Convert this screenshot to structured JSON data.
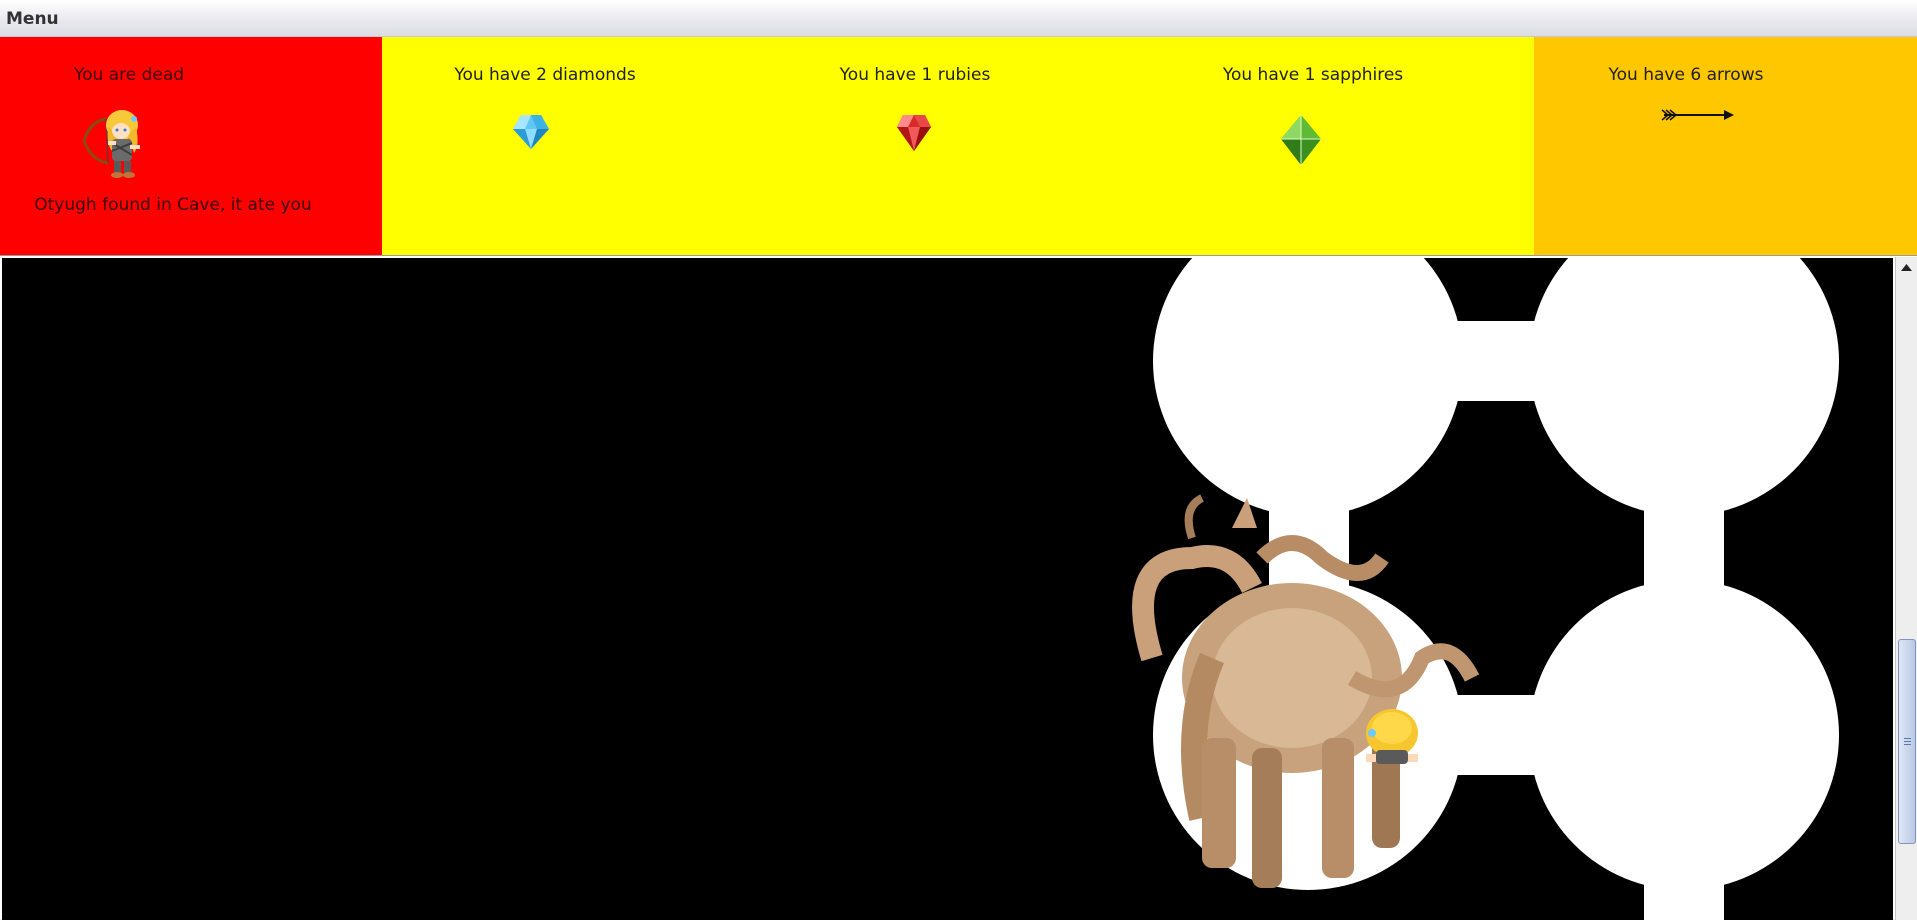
{
  "menu": {
    "label": "Menu"
  },
  "status": {
    "player_state": "You are dead",
    "message": "Otyugh found in Cave, it ate you",
    "background": "#ff0000"
  },
  "inventory": {
    "background": "#ffff00",
    "diamonds_text": "You have 2 diamonds",
    "rubies_text": "You have 1 rubies",
    "sapphires_text": "You have 1 sapphires",
    "diamond_icon": "diamond-icon",
    "ruby_icon": "ruby-icon",
    "sapphire_icon": "sapphire-icon"
  },
  "arrows": {
    "text": "You have 6 arrows",
    "background": "#ffc700",
    "icon": "arrow-icon"
  },
  "map": {
    "background": "#000000",
    "cave_color": "#ffffff",
    "monster": "otyugh",
    "player_icon": "player-icon"
  }
}
